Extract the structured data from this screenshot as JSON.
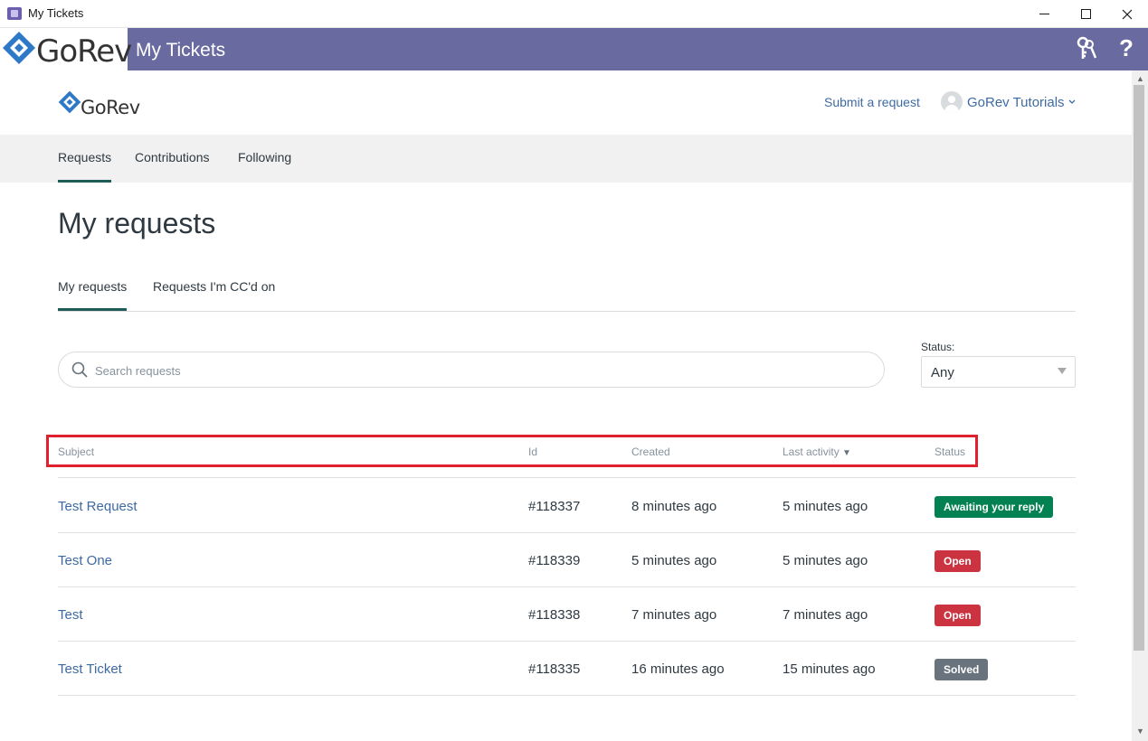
{
  "window": {
    "title": "My Tickets",
    "controls": [
      "minimize",
      "maximize",
      "close"
    ]
  },
  "appbar": {
    "logo_text": "GoRev",
    "title": "My Tickets",
    "background": "#696aa0",
    "right_icons": [
      "keys-icon",
      "help-icon"
    ],
    "help_glyph": "?"
  },
  "site": {
    "logo_text": "GoRev",
    "submit_link": "Submit a request",
    "user_name": "GoRev Tutorials",
    "user_chevron": "⌄"
  },
  "subnav": {
    "items": [
      {
        "label": "Requests",
        "active": true
      },
      {
        "label": "Contributions",
        "active": false
      },
      {
        "label": "Following",
        "active": false
      }
    ]
  },
  "page": {
    "title": "My requests",
    "tabs": [
      {
        "label": "My requests",
        "active": true
      },
      {
        "label": "Requests I'm CC'd on",
        "active": false
      }
    ]
  },
  "search": {
    "placeholder": "Search requests",
    "value": ""
  },
  "status_filter": {
    "label": "Status:",
    "selected": "Any"
  },
  "table": {
    "columns": {
      "subject": "Subject",
      "id": "Id",
      "created": "Created",
      "last_activity": "Last activity",
      "sort_indicator": "▼",
      "status": "Status"
    },
    "rows": [
      {
        "subject": "Test Request",
        "id": "#118337",
        "created": "8 minutes ago",
        "last_activity": "5 minutes ago",
        "status": "Awaiting your reply"
      },
      {
        "subject": "Test One",
        "id": "#118339",
        "created": "5 minutes ago",
        "last_activity": "5 minutes ago",
        "status": "Open"
      },
      {
        "subject": "Test",
        "id": "#118338",
        "created": "7 minutes ago",
        "last_activity": "7 minutes ago",
        "status": "Open"
      },
      {
        "subject": "Test Ticket",
        "id": "#118335",
        "created": "16 minutes ago",
        "last_activity": "15 minutes ago",
        "status": "Solved"
      }
    ]
  },
  "colors": {
    "accent_link": "#3e6aa3",
    "tab_underline": "#1f5c58",
    "status_awaiting": "#038153",
    "status_open": "#cc3340",
    "status_solved": "#68737d",
    "highlight_box": "#e0202f"
  }
}
